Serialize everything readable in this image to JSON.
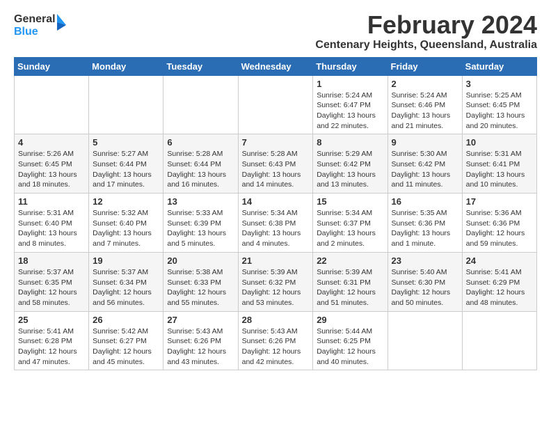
{
  "header": {
    "logo_general": "General",
    "logo_blue": "Blue",
    "month_year": "February 2024",
    "location": "Centenary Heights, Queensland, Australia"
  },
  "weekdays": [
    "Sunday",
    "Monday",
    "Tuesday",
    "Wednesday",
    "Thursday",
    "Friday",
    "Saturday"
  ],
  "weeks": [
    [
      {
        "day": "",
        "detail": ""
      },
      {
        "day": "",
        "detail": ""
      },
      {
        "day": "",
        "detail": ""
      },
      {
        "day": "",
        "detail": ""
      },
      {
        "day": "1",
        "detail": "Sunrise: 5:24 AM\nSunset: 6:47 PM\nDaylight: 13 hours\nand 22 minutes."
      },
      {
        "day": "2",
        "detail": "Sunrise: 5:24 AM\nSunset: 6:46 PM\nDaylight: 13 hours\nand 21 minutes."
      },
      {
        "day": "3",
        "detail": "Sunrise: 5:25 AM\nSunset: 6:45 PM\nDaylight: 13 hours\nand 20 minutes."
      }
    ],
    [
      {
        "day": "4",
        "detail": "Sunrise: 5:26 AM\nSunset: 6:45 PM\nDaylight: 13 hours\nand 18 minutes."
      },
      {
        "day": "5",
        "detail": "Sunrise: 5:27 AM\nSunset: 6:44 PM\nDaylight: 13 hours\nand 17 minutes."
      },
      {
        "day": "6",
        "detail": "Sunrise: 5:28 AM\nSunset: 6:44 PM\nDaylight: 13 hours\nand 16 minutes."
      },
      {
        "day": "7",
        "detail": "Sunrise: 5:28 AM\nSunset: 6:43 PM\nDaylight: 13 hours\nand 14 minutes."
      },
      {
        "day": "8",
        "detail": "Sunrise: 5:29 AM\nSunset: 6:42 PM\nDaylight: 13 hours\nand 13 minutes."
      },
      {
        "day": "9",
        "detail": "Sunrise: 5:30 AM\nSunset: 6:42 PM\nDaylight: 13 hours\nand 11 minutes."
      },
      {
        "day": "10",
        "detail": "Sunrise: 5:31 AM\nSunset: 6:41 PM\nDaylight: 13 hours\nand 10 minutes."
      }
    ],
    [
      {
        "day": "11",
        "detail": "Sunrise: 5:31 AM\nSunset: 6:40 PM\nDaylight: 13 hours\nand 8 minutes."
      },
      {
        "day": "12",
        "detail": "Sunrise: 5:32 AM\nSunset: 6:40 PM\nDaylight: 13 hours\nand 7 minutes."
      },
      {
        "day": "13",
        "detail": "Sunrise: 5:33 AM\nSunset: 6:39 PM\nDaylight: 13 hours\nand 5 minutes."
      },
      {
        "day": "14",
        "detail": "Sunrise: 5:34 AM\nSunset: 6:38 PM\nDaylight: 13 hours\nand 4 minutes."
      },
      {
        "day": "15",
        "detail": "Sunrise: 5:34 AM\nSunset: 6:37 PM\nDaylight: 13 hours\nand 2 minutes."
      },
      {
        "day": "16",
        "detail": "Sunrise: 5:35 AM\nSunset: 6:36 PM\nDaylight: 13 hours\nand 1 minute."
      },
      {
        "day": "17",
        "detail": "Sunrise: 5:36 AM\nSunset: 6:36 PM\nDaylight: 12 hours\nand 59 minutes."
      }
    ],
    [
      {
        "day": "18",
        "detail": "Sunrise: 5:37 AM\nSunset: 6:35 PM\nDaylight: 12 hours\nand 58 minutes."
      },
      {
        "day": "19",
        "detail": "Sunrise: 5:37 AM\nSunset: 6:34 PM\nDaylight: 12 hours\nand 56 minutes."
      },
      {
        "day": "20",
        "detail": "Sunrise: 5:38 AM\nSunset: 6:33 PM\nDaylight: 12 hours\nand 55 minutes."
      },
      {
        "day": "21",
        "detail": "Sunrise: 5:39 AM\nSunset: 6:32 PM\nDaylight: 12 hours\nand 53 minutes."
      },
      {
        "day": "22",
        "detail": "Sunrise: 5:39 AM\nSunset: 6:31 PM\nDaylight: 12 hours\nand 51 minutes."
      },
      {
        "day": "23",
        "detail": "Sunrise: 5:40 AM\nSunset: 6:30 PM\nDaylight: 12 hours\nand 50 minutes."
      },
      {
        "day": "24",
        "detail": "Sunrise: 5:41 AM\nSunset: 6:29 PM\nDaylight: 12 hours\nand 48 minutes."
      }
    ],
    [
      {
        "day": "25",
        "detail": "Sunrise: 5:41 AM\nSunset: 6:28 PM\nDaylight: 12 hours\nand 47 minutes."
      },
      {
        "day": "26",
        "detail": "Sunrise: 5:42 AM\nSunset: 6:27 PM\nDaylight: 12 hours\nand 45 minutes."
      },
      {
        "day": "27",
        "detail": "Sunrise: 5:43 AM\nSunset: 6:26 PM\nDaylight: 12 hours\nand 43 minutes."
      },
      {
        "day": "28",
        "detail": "Sunrise: 5:43 AM\nSunset: 6:26 PM\nDaylight: 12 hours\nand 42 minutes."
      },
      {
        "day": "29",
        "detail": "Sunrise: 5:44 AM\nSunset: 6:25 PM\nDaylight: 12 hours\nand 40 minutes."
      },
      {
        "day": "",
        "detail": ""
      },
      {
        "day": "",
        "detail": ""
      }
    ]
  ]
}
